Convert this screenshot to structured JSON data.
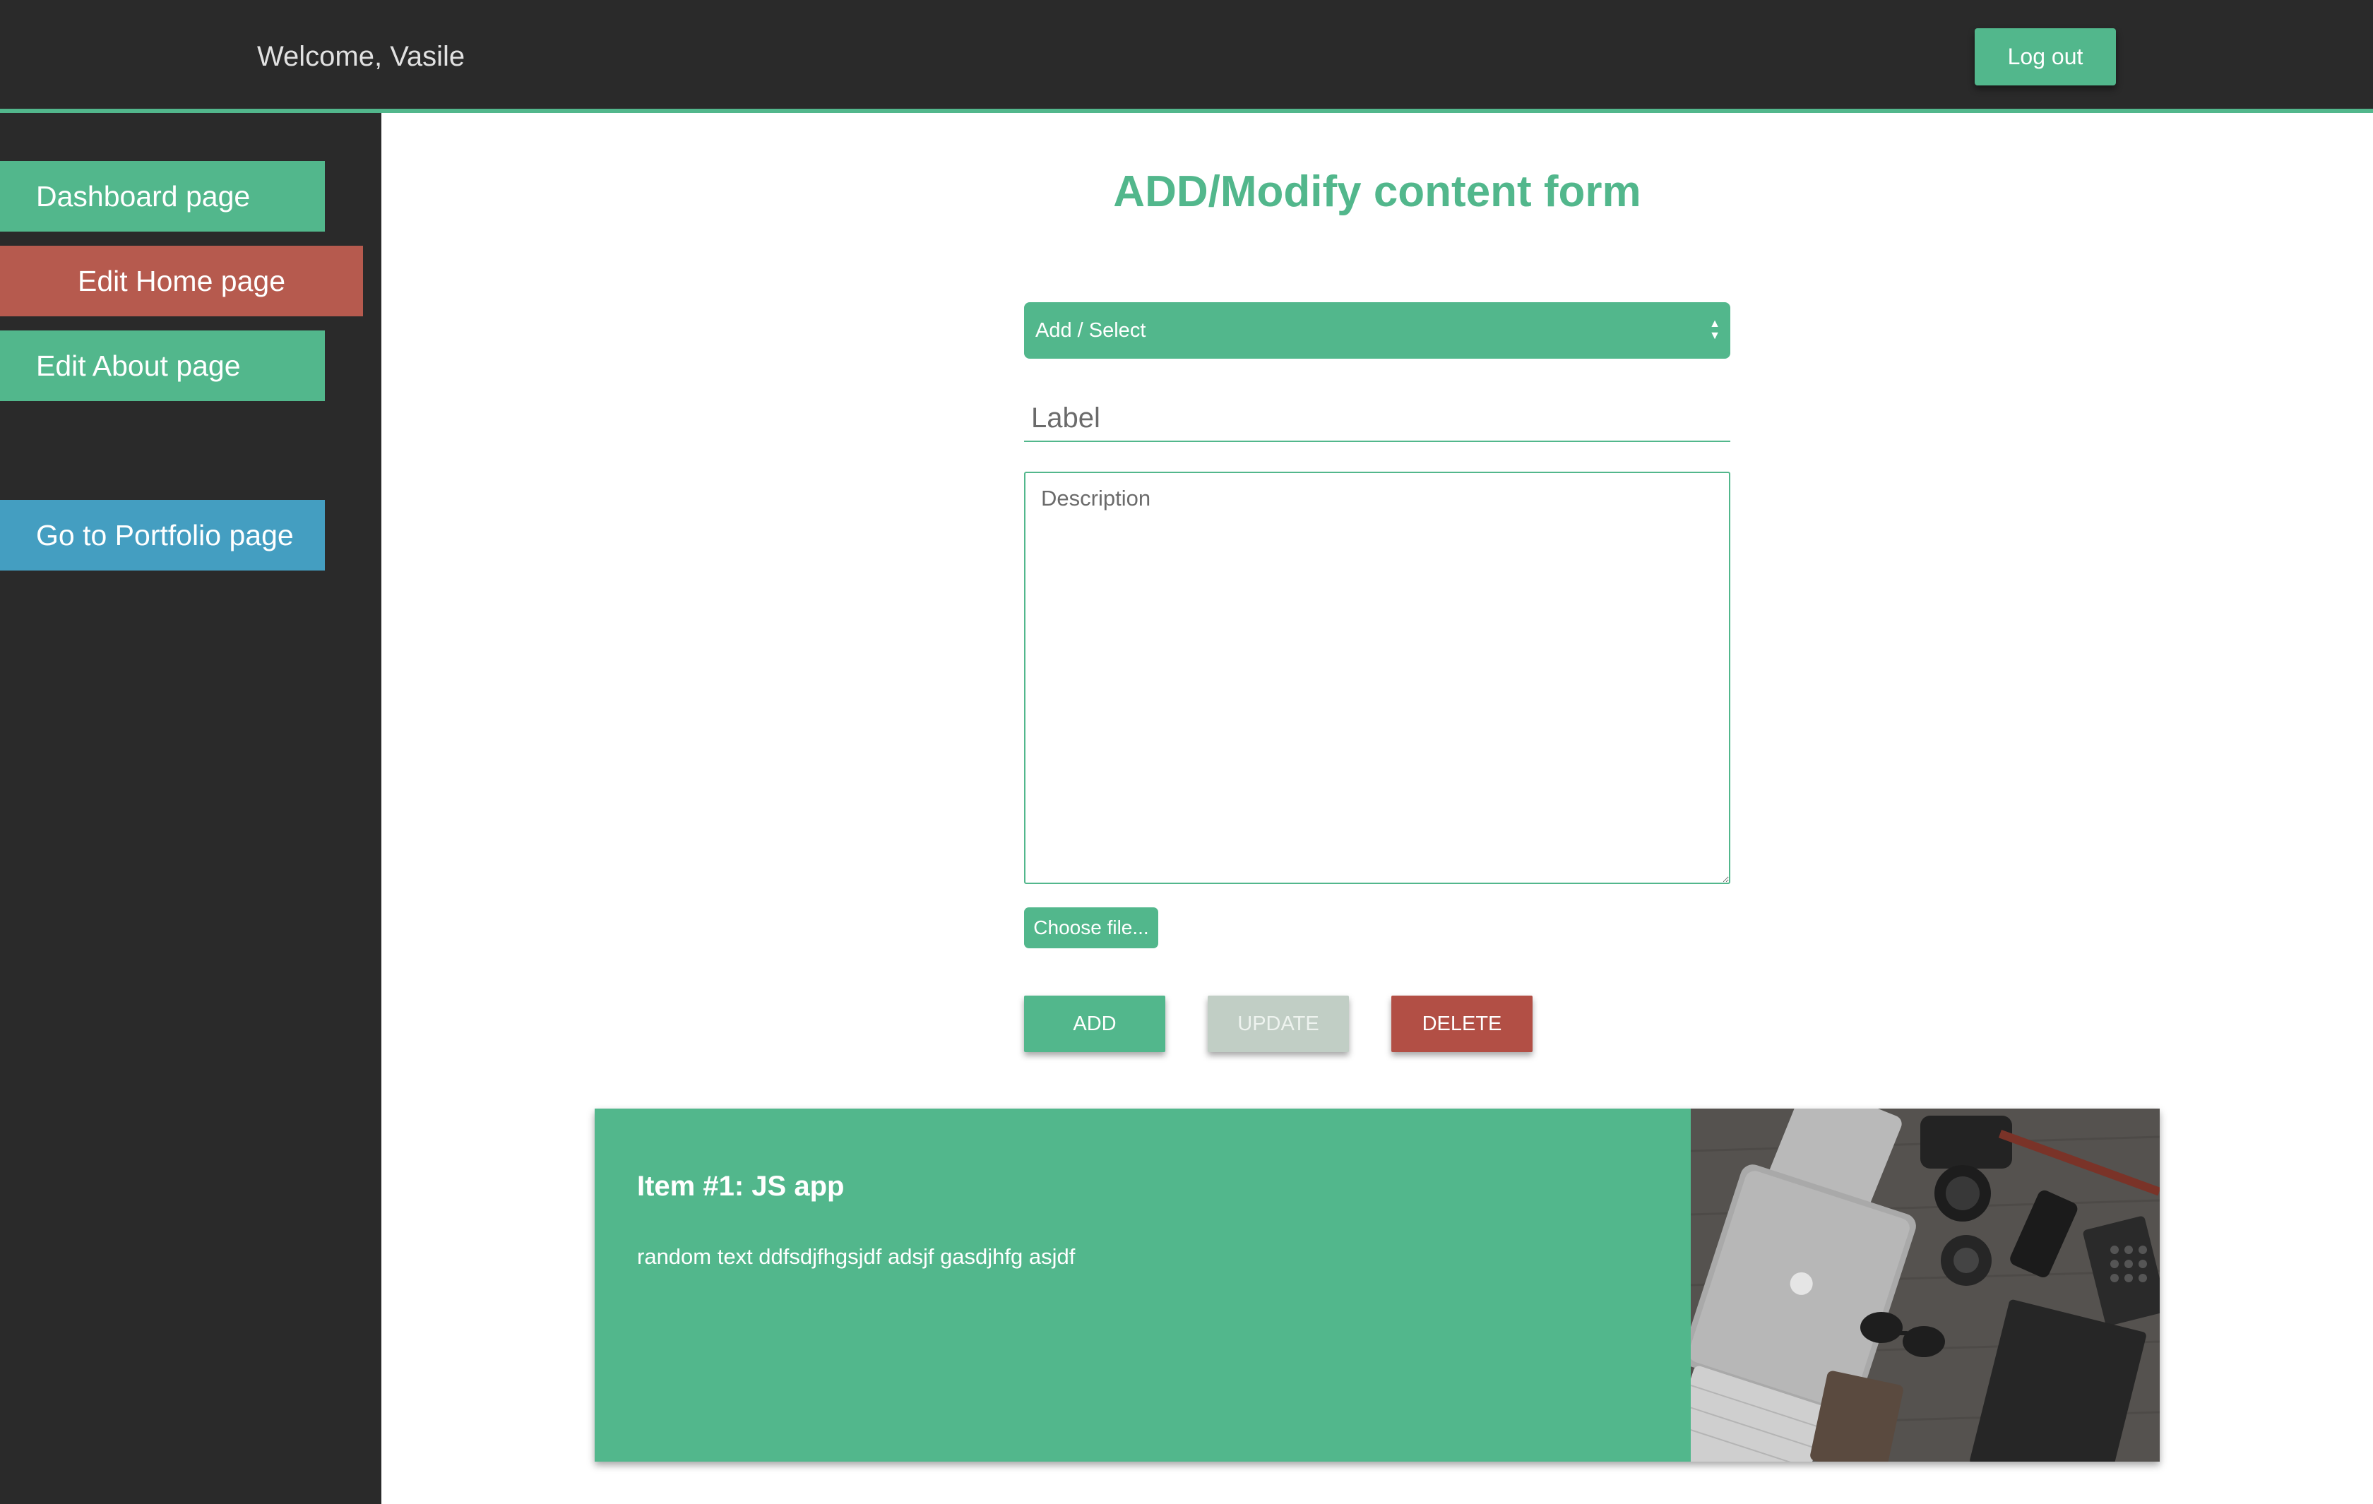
{
  "header": {
    "welcome_text": "Welcome, Vasile",
    "logout_label": "Log out"
  },
  "sidebar": {
    "items": [
      {
        "label": "Dashboard page"
      },
      {
        "label": "Edit Home page",
        "active": true
      },
      {
        "label": "Edit About page"
      },
      {
        "label": "Go to Portfolio page"
      }
    ]
  },
  "form": {
    "title": "ADD/Modify content form",
    "select_value": "Add / Select",
    "label_placeholder": "Label",
    "description_placeholder": "Description",
    "file_button_label": "Choose file...",
    "add_label": "ADD",
    "update_label": "UPDATE",
    "delete_label": "DELETE"
  },
  "items": [
    {
      "title": "Item #1: JS app",
      "description": "random text ddfsdjfhgsjdf adsjf gasdjhfg asjdf"
    }
  ],
  "colors": {
    "accent": "#52b78c",
    "danger": "#b65a4e",
    "info": "#449ec1",
    "disabled": "#c1cec5",
    "dark": "#2a2a2a"
  }
}
